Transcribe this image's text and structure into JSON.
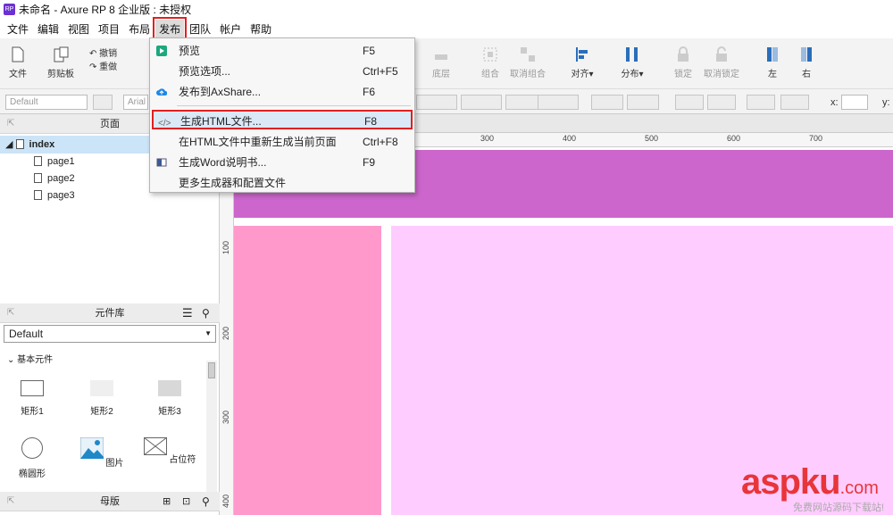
{
  "window": {
    "title": "未命名 - Axure RP 8 企业版 : 未授权",
    "logo_text": "RP"
  },
  "menubar": [
    "文件",
    "编辑",
    "视图",
    "项目",
    "布局",
    "发布",
    "团队",
    "帐户",
    "帮助"
  ],
  "toolbar": {
    "file": "文件",
    "clipboard": "剪贴板",
    "undo": "撤销",
    "redo": "重做",
    "bottom_layer": "底层",
    "group": "组合",
    "ungroup": "取消组合",
    "align": "对齐▾",
    "distribute": "分布▾",
    "lock": "锁定",
    "unlock": "取消锁定",
    "left": "左",
    "right": "右"
  },
  "formatbar": {
    "style": "Default",
    "font": "Arial",
    "x_label": "x:",
    "y_label": "y:"
  },
  "pages_panel": {
    "title": "页面",
    "pages": [
      "index",
      "page1",
      "page2",
      "page3"
    ]
  },
  "library_panel": {
    "title": "元件库",
    "selected_library": "Default",
    "section": "基本元件",
    "widgets": [
      "矩形1",
      "矩形2",
      "矩形3",
      "椭圆形",
      "图片",
      "占位符"
    ]
  },
  "masters_panel": {
    "title": "母版"
  },
  "ruler": {
    "top_labels": [
      "300",
      "400",
      "500",
      "600",
      "700"
    ],
    "left_labels": [
      "100",
      "200",
      "300",
      "400"
    ]
  },
  "publish_menu": {
    "items": [
      {
        "label": "预览",
        "shortcut": "F5",
        "icon": "play-icon"
      },
      {
        "label": "预览选项...",
        "shortcut": "Ctrl+F5",
        "icon": ""
      },
      {
        "label": "发布到AxShare...",
        "shortcut": "F6",
        "icon": "cloud-upload-icon"
      },
      {
        "label": "生成HTML文件...",
        "shortcut": "F8",
        "icon": "code-icon"
      },
      {
        "label": "在HTML文件中重新生成当前页面",
        "shortcut": "Ctrl+F8",
        "icon": ""
      },
      {
        "label": "生成Word说明书...",
        "shortcut": "F9",
        "icon": "word-doc-icon"
      },
      {
        "label": "更多生成器和配置文件",
        "shortcut": "",
        "icon": ""
      }
    ]
  },
  "canvas": {
    "header_color": "#cc66cc",
    "sidebar_color": "#ff99cc",
    "content_color": "#ffccff"
  },
  "watermark": {
    "brand": "aspku",
    "tld": ".com",
    "tagline": "免费网站源码下载站!"
  }
}
